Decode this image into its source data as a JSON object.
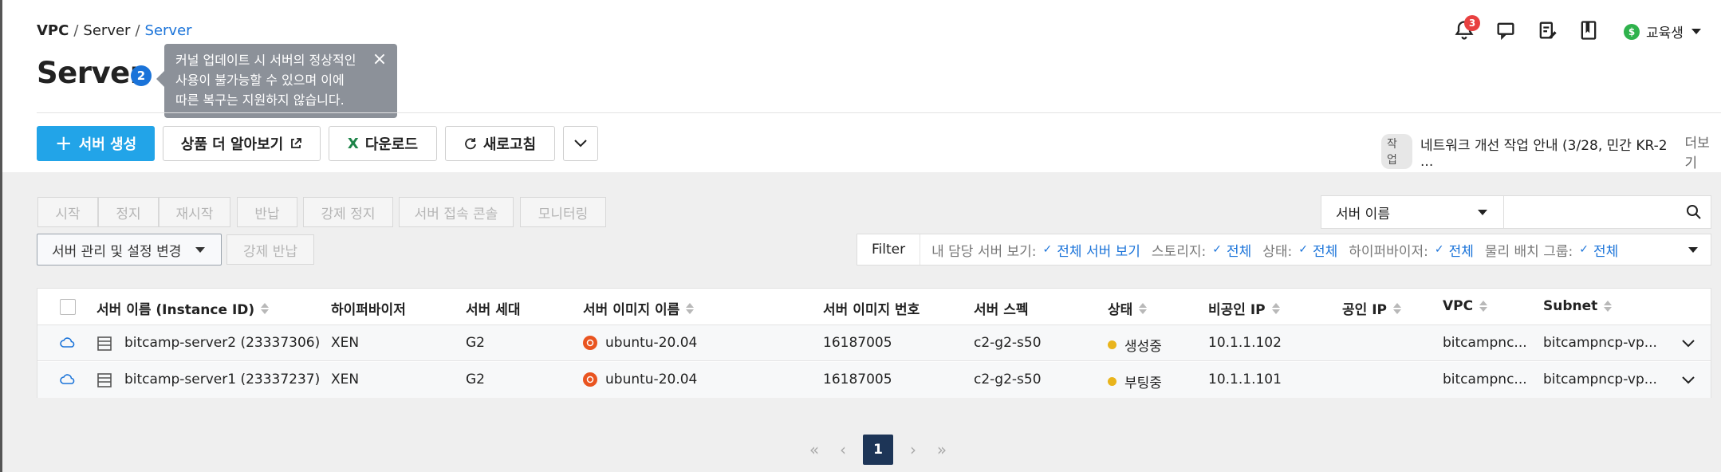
{
  "breadcrumb": {
    "first": "VPC",
    "second": "Server",
    "current": "Server",
    "sep": "/"
  },
  "page": {
    "title": "Server",
    "badge": "2"
  },
  "tooltip": {
    "line1": "커널 업데이트 시 서버의 정상적인",
    "line2": "사용이 불가능할 수 있으며 이에",
    "line3": "따른 복구는 지원하지 않습니다.",
    "close": "×"
  },
  "header": {
    "notification_count": "3",
    "user_name": "교육생",
    "coin_symbol": "$"
  },
  "toolbar": {
    "create_label": "서버 생성",
    "learn_label": "상품 더 알아보기",
    "download_label": "다운로드",
    "refresh_label": "새로고침"
  },
  "notice": {
    "tag": "작업",
    "text": "네트워크 개선 작업 안내 (3/28, 민간 KR-2 ...",
    "more": "더보기"
  },
  "actions": [
    "시작",
    "정지",
    "재시작",
    "반납",
    "강제 정지",
    "서버 접속 콘솔",
    "모니터링"
  ],
  "actions2": {
    "manage": "서버 관리 및 설정 변경",
    "force_return": "강제 반납"
  },
  "search": {
    "field": "서버 이름",
    "value": ""
  },
  "filter": {
    "label": "Filter",
    "items": [
      {
        "key": "내 담당 서버 보기:",
        "value": "전체 서버 보기"
      },
      {
        "key": "스토리지:",
        "value": "전체"
      },
      {
        "key": "상태:",
        "value": "전체"
      },
      {
        "key": "하이퍼바이저:",
        "value": "전체"
      },
      {
        "key": "물리 배치 그룹:",
        "value": "전체"
      }
    ]
  },
  "table": {
    "headers": [
      "서버 이름 (Instance ID)",
      "하이퍼바이저",
      "서버 세대",
      "서버 이미지 이름",
      "서버 이미지 번호",
      "서버 스펙",
      "상태",
      "비공인 IP",
      "공인 IP",
      "VPC",
      "Subnet"
    ],
    "rows": [
      {
        "name": "bitcamp-server2 (23337306)",
        "hypervisor": "XEN",
        "gen": "G2",
        "image": "ubuntu-20.04",
        "image_no": "16187005",
        "spec": "c2-g2-s50",
        "status": "생성중",
        "private_ip": "10.1.1.102",
        "public_ip": "",
        "vpc": "bitcampnc...",
        "subnet": "bitcampncp-vp..."
      },
      {
        "name": "bitcamp-server1 (23337237)",
        "hypervisor": "XEN",
        "gen": "G2",
        "image": "ubuntu-20.04",
        "image_no": "16187005",
        "spec": "c2-g2-s50",
        "status": "부팅중",
        "private_ip": "10.1.1.101",
        "public_ip": "",
        "vpc": "bitcampnc...",
        "subnet": "bitcampncp-vp..."
      }
    ]
  },
  "pager": {
    "current": "1"
  },
  "colors": {
    "primary": "#22a4e8",
    "link": "#1a73d9",
    "status_dot": "#e9b41c",
    "pager_active": "#1d3557"
  }
}
